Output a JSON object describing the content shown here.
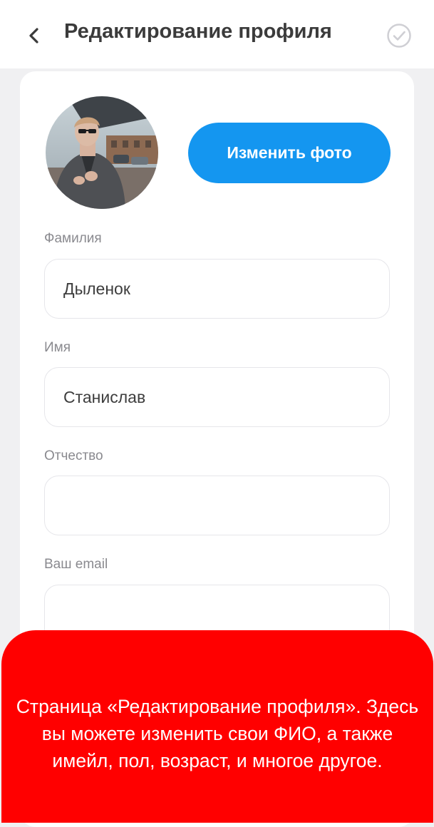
{
  "header": {
    "title": "Редактирование профиля",
    "back_icon": "chevron-left-icon",
    "confirm_icon": "check-circle-icon"
  },
  "profile": {
    "avatar_alt": "Фото профиля",
    "change_photo_label": "Изменить фото"
  },
  "form": {
    "last_name": {
      "label": "Фамилия",
      "value": "Дыленок",
      "placeholder": ""
    },
    "first_name": {
      "label": "Имя",
      "value": "Станислав",
      "placeholder": ""
    },
    "patronymic": {
      "label": "Отчество",
      "value": "",
      "placeholder": ""
    },
    "email": {
      "label": "Ваш email",
      "value": "",
      "placeholder": ""
    }
  },
  "banner": {
    "text": "Страница «Редактирование профиля». Здесь вы можете изменить свои ФИО, а также имейл, пол, возраст, и многое другое."
  },
  "colors": {
    "accent": "#1496f0",
    "banner": "#ff0000",
    "background": "#f0f0f2"
  }
}
